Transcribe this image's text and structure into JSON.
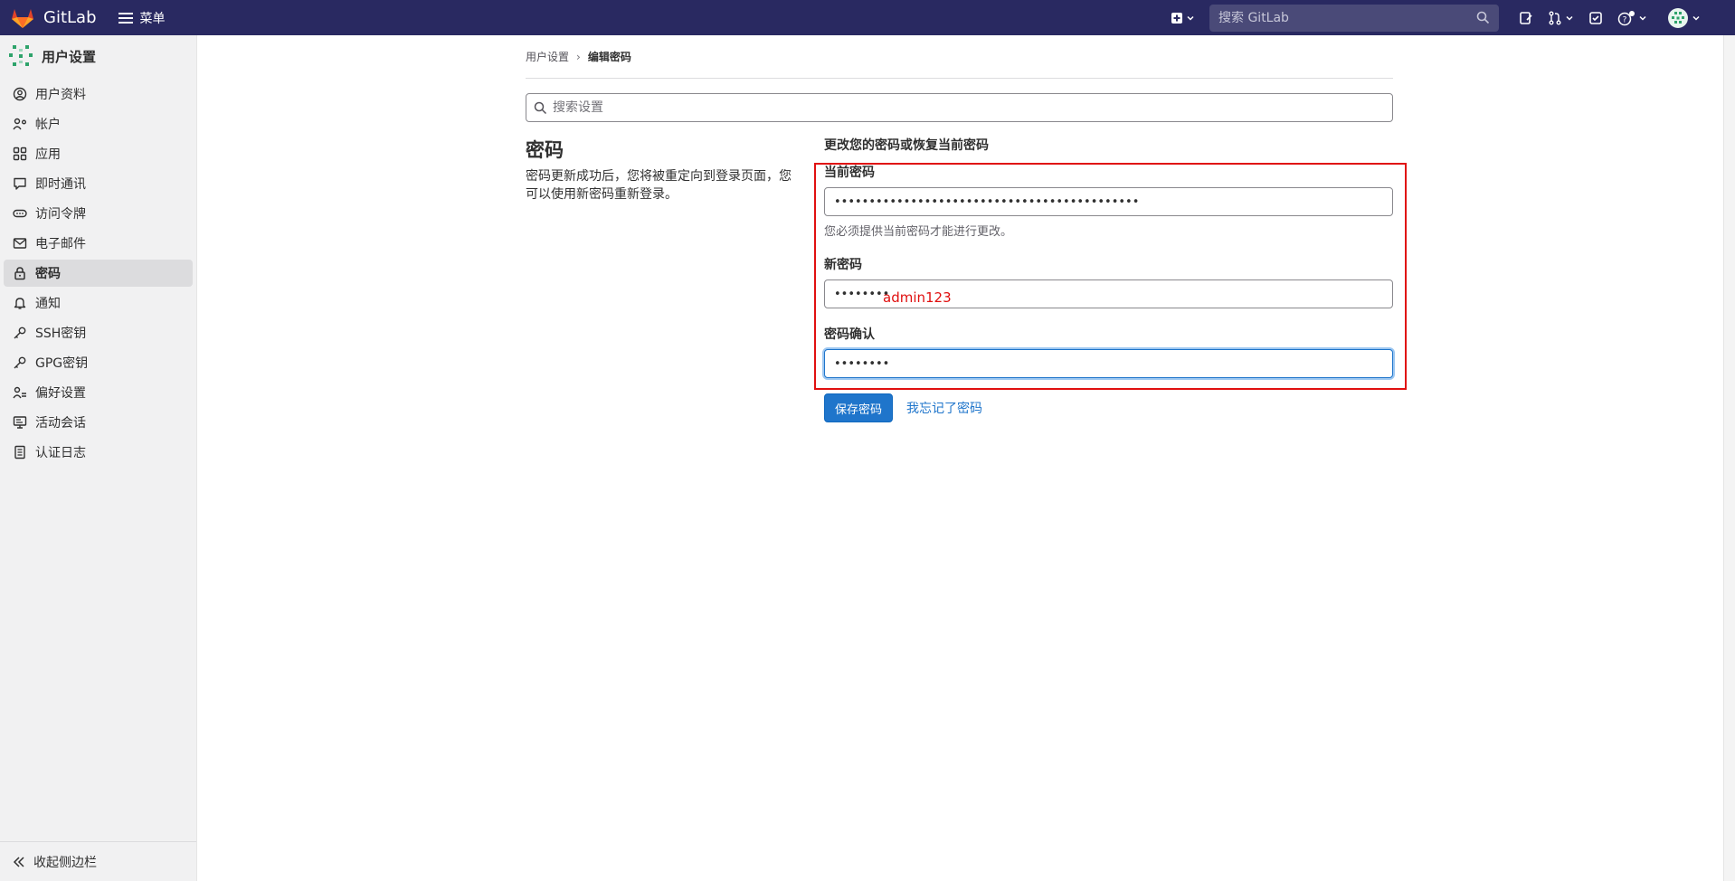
{
  "topbar": {
    "brand": "GitLab",
    "menu_label": "菜单",
    "search_placeholder": "搜索 GitLab"
  },
  "sidebar": {
    "title": "用户设置",
    "items": [
      {
        "label": "用户资料",
        "icon": "profile-icon"
      },
      {
        "label": "帐户",
        "icon": "account-icon"
      },
      {
        "label": "应用",
        "icon": "applications-icon"
      },
      {
        "label": "即时通讯",
        "icon": "chat-icon"
      },
      {
        "label": "访问令牌",
        "icon": "token-icon"
      },
      {
        "label": "电子邮件",
        "icon": "mail-icon"
      },
      {
        "label": "密码",
        "icon": "lock-icon",
        "active": true
      },
      {
        "label": "通知",
        "icon": "bell-icon"
      },
      {
        "label": "SSH密钥",
        "icon": "key-icon"
      },
      {
        "label": "GPG密钥",
        "icon": "key-icon"
      },
      {
        "label": "偏好设置",
        "icon": "preferences-icon"
      },
      {
        "label": "活动会话",
        "icon": "monitor-icon"
      },
      {
        "label": "认证日志",
        "icon": "log-icon"
      }
    ],
    "collapse_label": "收起侧边栏"
  },
  "breadcrumb": {
    "parent": "用户设置",
    "separator": "›",
    "current": "编辑密码"
  },
  "settings_search": {
    "placeholder": "搜索设置"
  },
  "section": {
    "title": "密码",
    "description": "密码更新成功后，您将被重定向到登录页面，您可以使用新密码重新登录。"
  },
  "form": {
    "heading": "更改您的密码或恢复当前密码",
    "current_label": "当前密码",
    "current_value": "••••••••••••••••••••••••••••••••••••••••••••",
    "current_help": "您必须提供当前密码才能进行更改。",
    "new_label": "新密码",
    "new_value": "••••••••",
    "confirm_label": "密码确认",
    "confirm_value": "••••••••",
    "save_label": "保存密码",
    "forgot_label": "我忘记了密码"
  },
  "annotation": {
    "text": "admin123",
    "color": "#e01010"
  },
  "colors": {
    "topbar": "#292961",
    "accent": "#1f75cb",
    "sidebar_bg": "#f1f1f2"
  }
}
